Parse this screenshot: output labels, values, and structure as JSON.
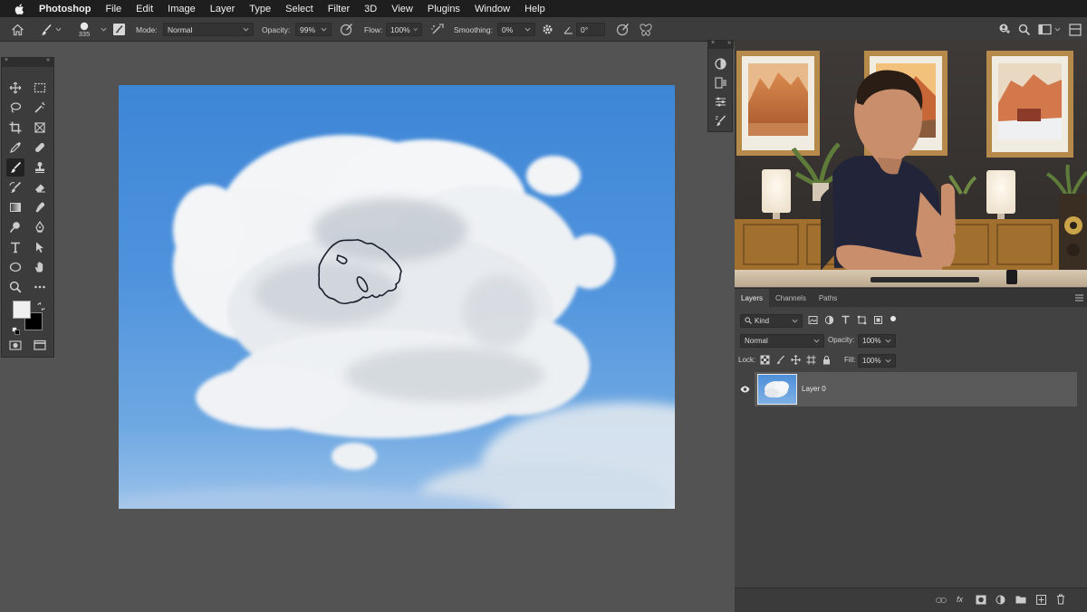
{
  "menubar": {
    "app_name": "Photoshop",
    "items": [
      "File",
      "Edit",
      "Image",
      "Layer",
      "Type",
      "Select",
      "Filter",
      "3D",
      "View",
      "Plugins",
      "Window",
      "Help"
    ]
  },
  "options_bar": {
    "brush_size": "335",
    "mode_label": "Mode:",
    "mode_value": "Normal",
    "opacity_label": "Opacity:",
    "opacity_value": "99%",
    "flow_label": "Flow:",
    "flow_value": "100%",
    "smoothing_label": "Smoothing:",
    "smoothing_value": "0%",
    "angle_value": "0°"
  },
  "layers_panel": {
    "tabs": [
      "Layers",
      "Channels",
      "Paths"
    ],
    "filter_kind": "Kind",
    "blend_mode": "Normal",
    "opacity_label": "Opacity:",
    "opacity_value": "100%",
    "lock_label": "Lock:",
    "fill_label": "Fill:",
    "fill_value": "100%",
    "layers": [
      {
        "name": "Layer 0",
        "visible": true
      }
    ],
    "footer_fx": "fx"
  },
  "colors": {
    "app_bg": "#535353",
    "panel_bg": "#3c3c3c",
    "menubar_bg": "#1e1e1e",
    "sky_blue": "#4a8fdb",
    "foreground_swatch": "#f0f0f0",
    "background_swatch": "#000000"
  },
  "icons": {
    "toolbar": [
      "move-icon",
      "marquee-icon",
      "lasso-icon",
      "magic-wand-icon",
      "crop-icon",
      "frame-icon",
      "eyedropper-icon",
      "healing-icon",
      "brush-icon",
      "stamp-icon",
      "history-brush-icon",
      "eraser-icon",
      "gradient-icon",
      "smudge-icon",
      "dodge-icon",
      "pen-icon",
      "type-icon",
      "path-select-icon",
      "shape-icon",
      "hand-icon",
      "zoom-icon",
      "more-icon"
    ]
  }
}
